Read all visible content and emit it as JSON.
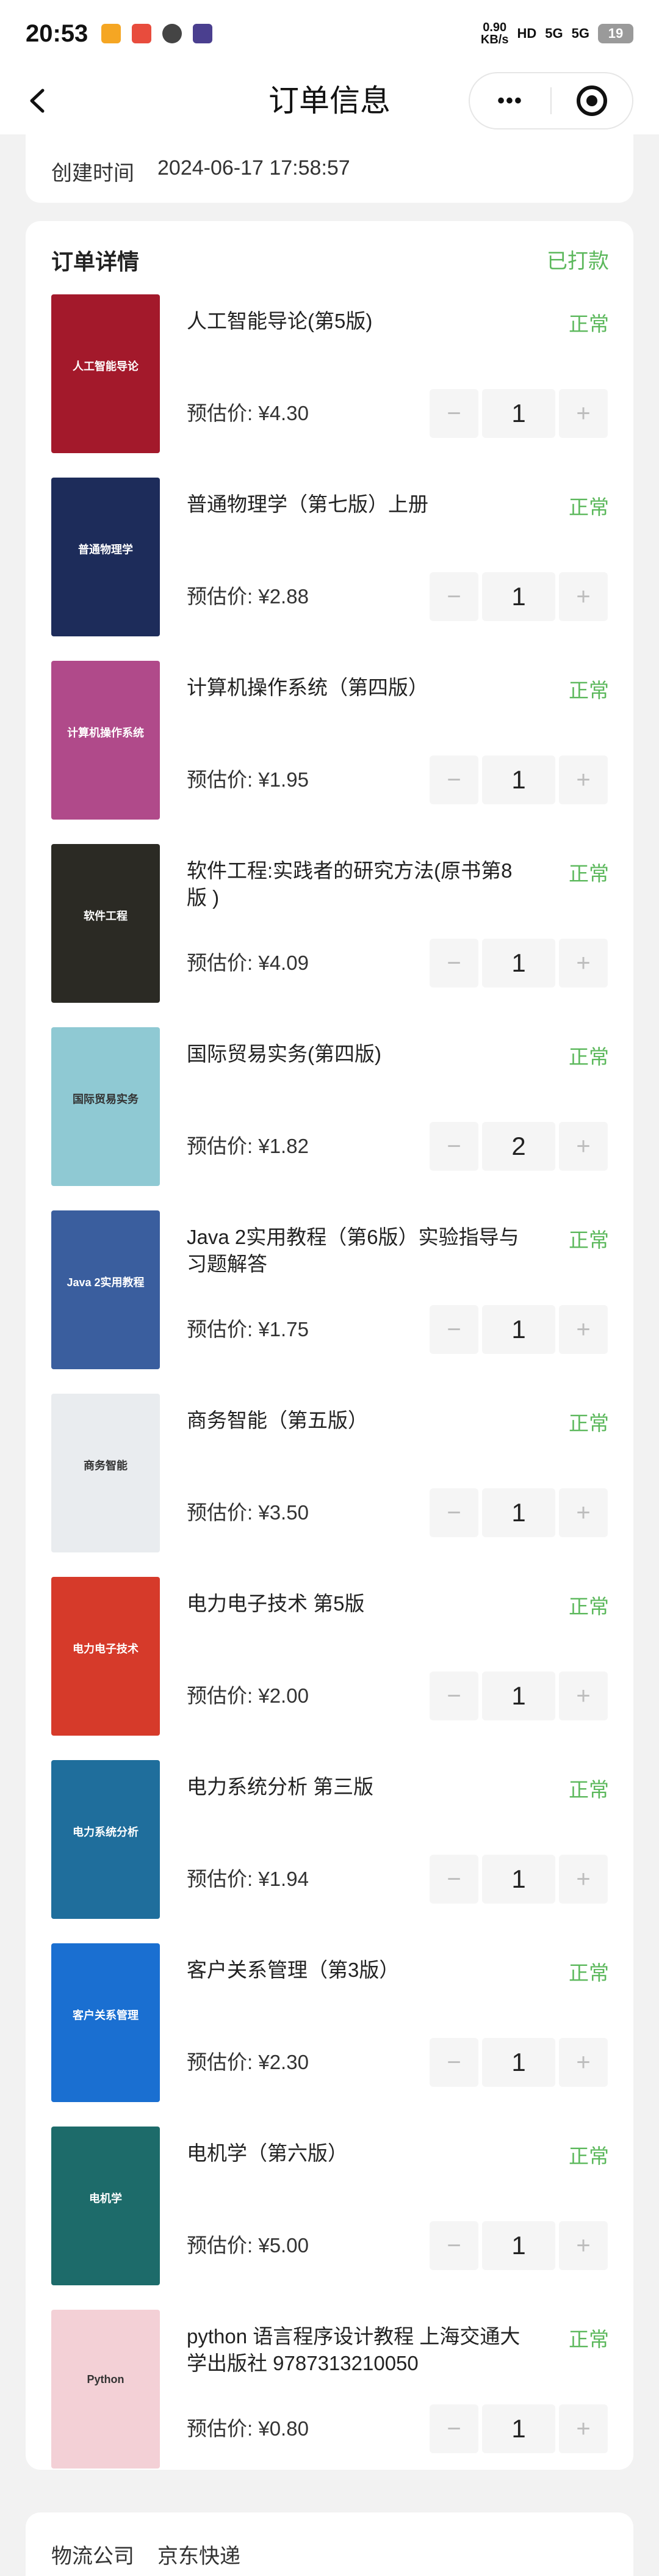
{
  "status_bar": {
    "time": "20:53",
    "net_speed_value": "0.90",
    "net_speed_unit": "KB/s",
    "hd_label": "HD",
    "signal_1": "5G",
    "signal_2": "5G",
    "battery": "19"
  },
  "nav": {
    "title": "订单信息",
    "more_label": "•••"
  },
  "order_time": {
    "label": "创建时间",
    "value": "2024-06-17 17:58:57"
  },
  "order_detail": {
    "title": "订单详情",
    "status": "已打款",
    "price_prefix": "预估价: ¥",
    "minus": "−",
    "plus": "+",
    "items": [
      {
        "name": "人工智能导论(第5版)",
        "state": "正常",
        "price": "4.30",
        "qty": "1",
        "cover_color": "#a3192b",
        "cover_text": "人工智能导论"
      },
      {
        "name": "普通物理学（第七版）上册",
        "state": "正常",
        "price": "2.88",
        "qty": "1",
        "cover_color": "#1d2c5a",
        "cover_text": "普通物理学"
      },
      {
        "name": "计算机操作系统（第四版）",
        "state": "正常",
        "price": "1.95",
        "qty": "1",
        "cover_color": "#b04a8a",
        "cover_text": "计算机操作系统"
      },
      {
        "name": "软件工程:实践者的研究方法(原书第8版 )",
        "state": "正常",
        "price": "4.09",
        "qty": "1",
        "cover_color": "#2b2a24",
        "cover_text": "软件工程"
      },
      {
        "name": "国际贸易实务(第四版)",
        "state": "正常",
        "price": "1.82",
        "qty": "2",
        "cover_color": "#8fc9d3",
        "cover_text": "国际贸易实务"
      },
      {
        "name": "Java 2实用教程（第6版）实验指导与习题解答",
        "state": "正常",
        "price": "1.75",
        "qty": "1",
        "cover_color": "#3a5e9e",
        "cover_text": "Java 2实用教程"
      },
      {
        "name": "商务智能（第五版）",
        "state": "正常",
        "price": "3.50",
        "qty": "1",
        "cover_color": "#e9ecef",
        "cover_text": "商务智能"
      },
      {
        "name": "电力电子技术 第5版",
        "state": "正常",
        "price": "2.00",
        "qty": "1",
        "cover_color": "#d63a2a",
        "cover_text": "电力电子技术"
      },
      {
        "name": "电力系统分析 第三版",
        "state": "正常",
        "price": "1.94",
        "qty": "1",
        "cover_color": "#1f6e9c",
        "cover_text": "电力系统分析"
      },
      {
        "name": "客户关系管理（第3版）",
        "state": "正常",
        "price": "2.30",
        "qty": "1",
        "cover_color": "#1a6fd1",
        "cover_text": "客户关系管理"
      },
      {
        "name": "电机学（第六版）",
        "state": "正常",
        "price": "5.00",
        "qty": "1",
        "cover_color": "#1d6b6a",
        "cover_text": "电机学"
      },
      {
        "name": "python 语言程序设计教程 上海交通大学出版社 9787313210050",
        "state": "正常",
        "price": "0.80",
        "qty": "1",
        "cover_color": "#f3d0d6",
        "cover_text": "Python"
      }
    ]
  },
  "logistics": {
    "company_label": "物流公司",
    "company_value": "京东快递"
  }
}
